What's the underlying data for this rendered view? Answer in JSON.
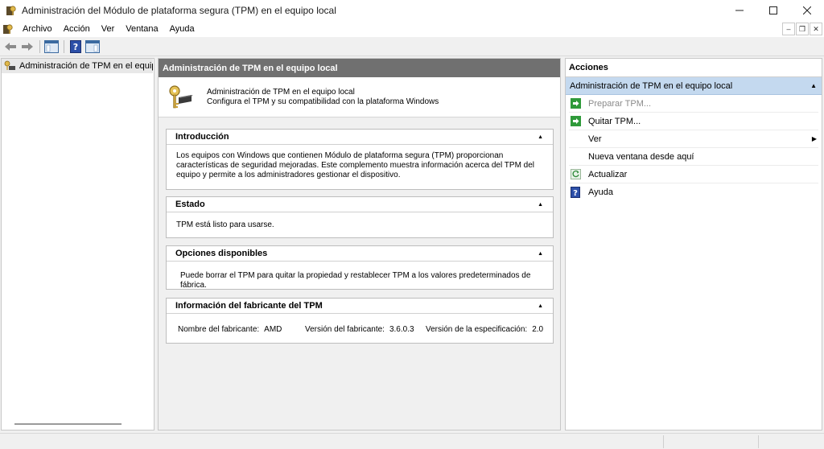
{
  "window": {
    "title": "Administración del Módulo de plataforma segura (TPM) en el equipo local",
    "icon": "tpm-key-icon",
    "controls": [
      "minimize-icon",
      "maximize-icon",
      "close-icon"
    ]
  },
  "menubar": {
    "items": [
      "Archivo",
      "Acción",
      "Ver",
      "Ventana",
      "Ayuda"
    ]
  },
  "toolbar": {
    "buttons": [
      "back-arrow-icon",
      "forward-arrow-icon",
      "show-hide-tree-icon",
      "help-icon",
      "show-hide-action-pane-icon"
    ]
  },
  "tree": {
    "root_label": "Administración de TPM en el equipo local"
  },
  "center": {
    "header": "Administración de TPM en el equipo local",
    "banner": {
      "line1": "Administración de TPM en el equipo local",
      "line2": "Configura el TPM y su compatibilidad con la plataforma Windows"
    },
    "sections": {
      "intro": {
        "title": "Introducción",
        "body": "Los equipos con Windows que contienen Módulo de plataforma segura (TPM) proporcionan características de seguridad mejoradas. Este complemento muestra información acerca del TPM del equipo y permite a los administradores gestionar el dispositivo."
      },
      "status": {
        "title": "Estado",
        "body": "TPM está listo para usarse."
      },
      "options": {
        "title": "Opciones disponibles",
        "body": "Puede borrar el TPM para quitar la propiedad y restablecer TPM a los valores predeterminados de fábrica."
      },
      "vendor": {
        "title": "Información del fabricante del TPM",
        "manufacturer_label": "Nombre del fabricante:",
        "manufacturer_value": "AMD",
        "version_label": "Versión del fabricante:",
        "version_value": "3.6.0.3",
        "spec_label": "Versión de la especificación:",
        "spec_value": "2.0"
      }
    }
  },
  "actions": {
    "header": "Acciones",
    "group_title": "Administración de TPM en el equipo local",
    "items": [
      {
        "label": "Preparar TPM...",
        "icon": "green-arrow-icon",
        "enabled": false
      },
      {
        "label": "Quitar TPM...",
        "icon": "green-arrow-icon",
        "enabled": true
      },
      {
        "label": "Ver",
        "icon": "",
        "enabled": true,
        "submenu": true
      },
      {
        "label": "Nueva ventana desde aquí",
        "icon": "",
        "enabled": true
      },
      {
        "label": "Actualizar",
        "icon": "refresh-icon",
        "enabled": true
      },
      {
        "label": "Ayuda",
        "icon": "help-icon",
        "enabled": true
      }
    ]
  }
}
